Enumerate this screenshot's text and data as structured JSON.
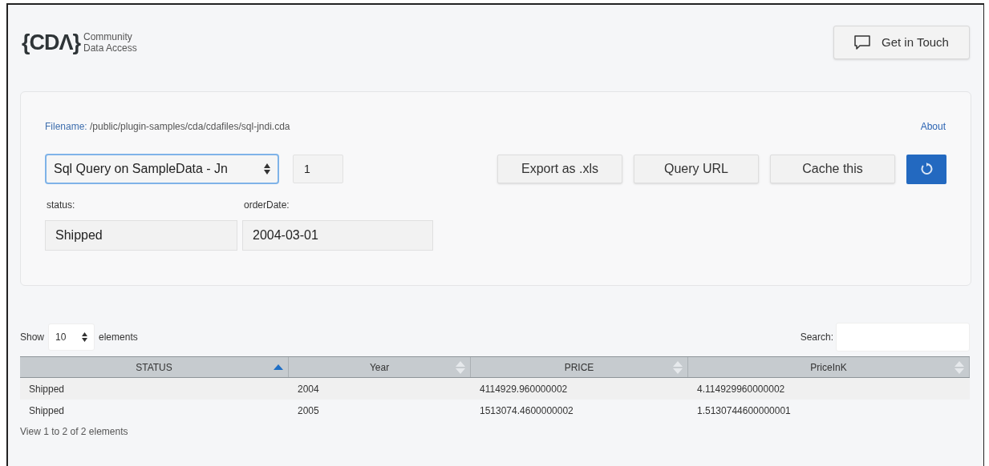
{
  "logo": {
    "mark": "{CDΛ}",
    "line_1": "Community",
    "line_2": "Data Access"
  },
  "contact_button": "Get in Touch",
  "query_panel": {
    "filename_label": "Filename:",
    "filename": "/public/plugin-samples/cda/cdafiles/sql-jndi.cda",
    "about_link": "About",
    "query_select": "Sql Query on SampleData - Jn",
    "output_index": "1",
    "buttons": [
      "Export as .xls",
      "Query URL",
      "Cache this"
    ],
    "parameters": [
      {
        "label": "status:",
        "value": "Shipped"
      },
      {
        "label": "orderDate:",
        "value": "2004-03-01"
      }
    ]
  },
  "table_controls": {
    "show_label": "Show",
    "page_size": "10",
    "elements_label": "elements",
    "search_label": "Search:"
  },
  "table": {
    "columns": [
      {
        "label": "STATUS",
        "sorted": true
      },
      {
        "label": "Year",
        "sorted": false
      },
      {
        "label": "PRICE",
        "sorted": false
      },
      {
        "label": "PriceInK",
        "sorted": false
      }
    ],
    "rows": [
      [
        "Shipped",
        "2004",
        "4114929.960000002",
        "4.114929960000002"
      ],
      [
        "Shipped",
        "2005",
        "1513074.4600000002",
        "1.5130744600000001"
      ]
    ]
  },
  "table_info": "View 1 to 2 of 2 elements"
}
